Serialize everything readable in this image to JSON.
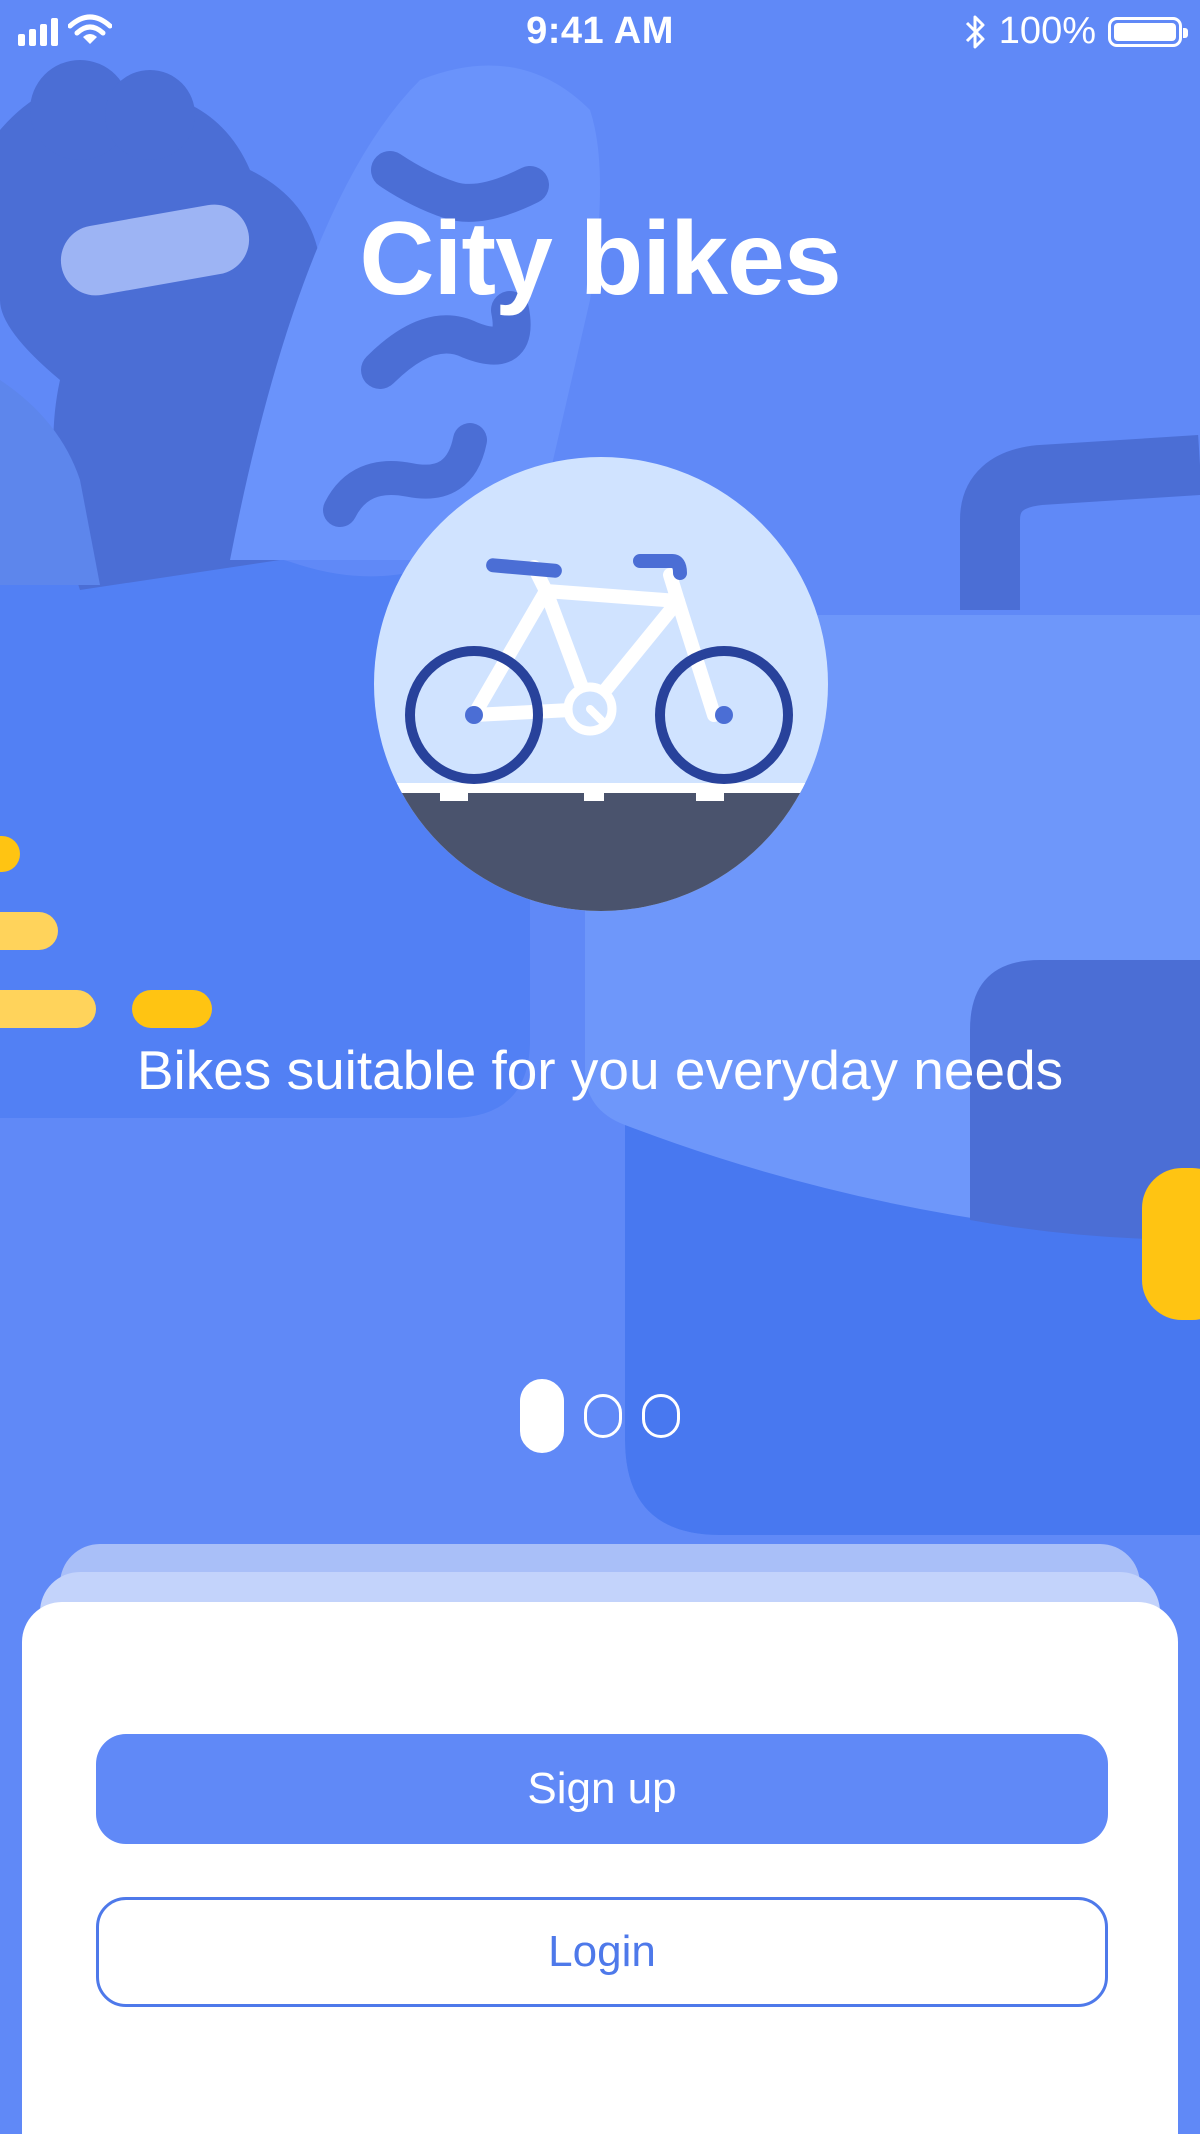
{
  "status_bar": {
    "time": "9:41 AM",
    "battery": "100%",
    "icons": [
      "signal-icon",
      "wifi-icon",
      "bluetooth-icon",
      "battery-icon"
    ]
  },
  "onboarding": {
    "title": "City bikes",
    "subtitle": "Bikes suitable for you everyday needs",
    "page_count": 3,
    "current_page": 1
  },
  "actions": {
    "signup_label": "Sign up",
    "login_label": "Login"
  },
  "colors": {
    "background": "#6089f7",
    "primary": "#6089f7",
    "accent_yellow": "#ffc412",
    "road": "#4a536d",
    "wheel": "#28429b"
  }
}
